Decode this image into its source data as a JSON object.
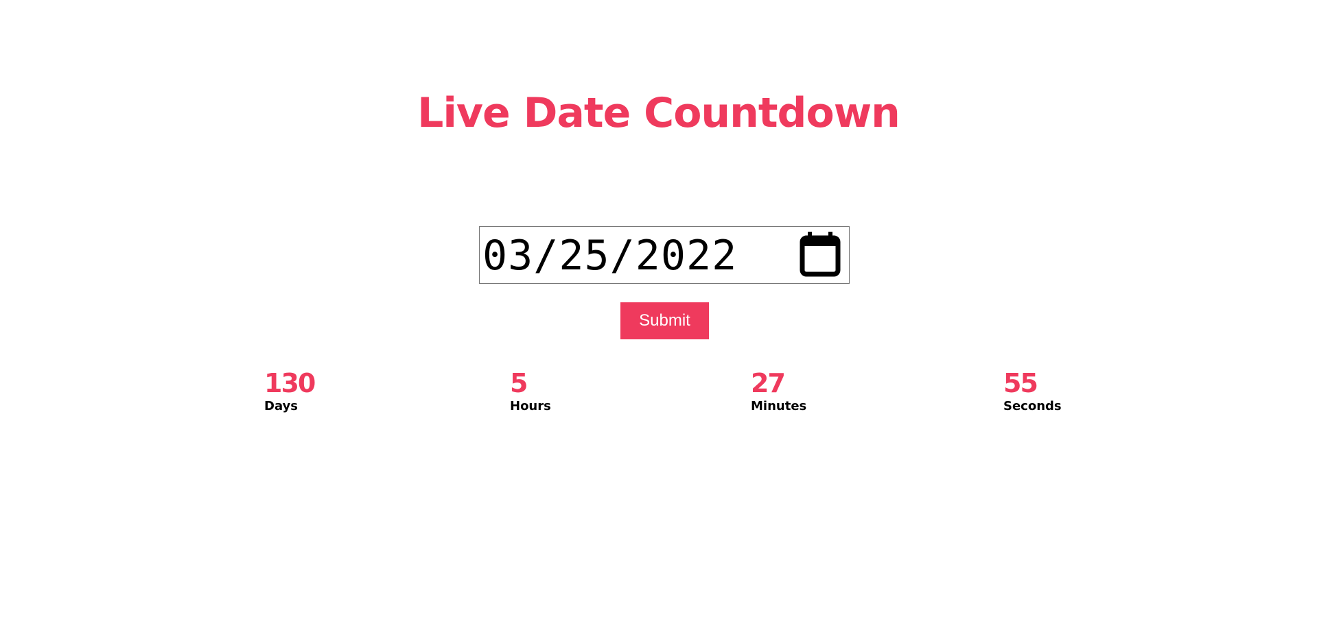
{
  "page": {
    "title": "Live Date Countdown"
  },
  "date_picker": {
    "value": "03/25/2022",
    "icon": "calendar-icon"
  },
  "submit": {
    "label": "Submit"
  },
  "countdown": [
    {
      "value": "130",
      "label": "Days"
    },
    {
      "value": "5",
      "label": "Hours"
    },
    {
      "value": "27",
      "label": "Minutes"
    },
    {
      "value": "55",
      "label": "Seconds"
    }
  ],
  "colors": {
    "accent": "#ef3a5d",
    "text": "#000000",
    "background": "#ffffff"
  }
}
